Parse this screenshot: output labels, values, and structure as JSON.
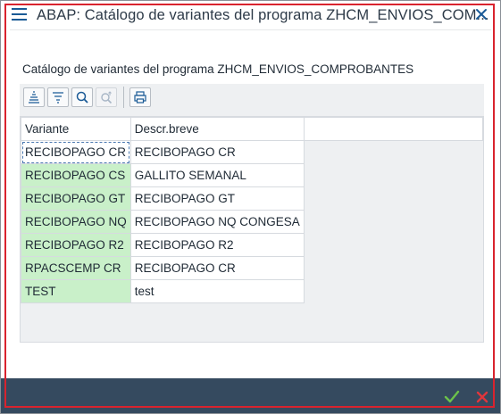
{
  "window": {
    "title": "ABAP: Catálogo de variantes del programa ZHCM_ENVIOS_COM..."
  },
  "header": {
    "subtitle": "Catálogo de variantes del programa ZHCM_ENVIOS_COMPROBANTES"
  },
  "toolbar": {
    "buttons": [
      {
        "name": "sort-ascending",
        "icon": "sort-ascending-icon",
        "enabled": true
      },
      {
        "name": "filter",
        "icon": "filter-icon",
        "enabled": true
      },
      {
        "name": "find",
        "icon": "search-icon",
        "enabled": true
      },
      {
        "name": "find-next",
        "icon": "search-next-icon",
        "enabled": false
      },
      {
        "name": "print",
        "icon": "printer-icon",
        "enabled": true
      }
    ]
  },
  "grid": {
    "columns": [
      "Variante",
      "Descr.breve"
    ],
    "rows": [
      [
        "RECIBOPAGO CR",
        "RECIBOPAGO CR"
      ],
      [
        "RECIBOPAGO CS",
        "GALLITO SEMANAL"
      ],
      [
        "RECIBOPAGO GT",
        "RECIBOPAGO GT"
      ],
      [
        "RECIBOPAGO NQ",
        "RECIBOPAGO NQ CONGESA"
      ],
      [
        "RECIBOPAGO R2",
        "RECIBOPAGO R2"
      ],
      [
        "RPACSCEMP CR",
        "RECIBOPAGO CR"
      ],
      [
        "TEST",
        "test"
      ]
    ]
  },
  "colors": {
    "title_text": "#2d3a48",
    "accent": "#1a5a96",
    "key_cell_bg": "#c9f0c9",
    "footer_bg": "#354a5f",
    "ok_icon": "#6cc24a",
    "cancel_icon": "#e0363c",
    "highlight_frame": "#d9232e"
  }
}
